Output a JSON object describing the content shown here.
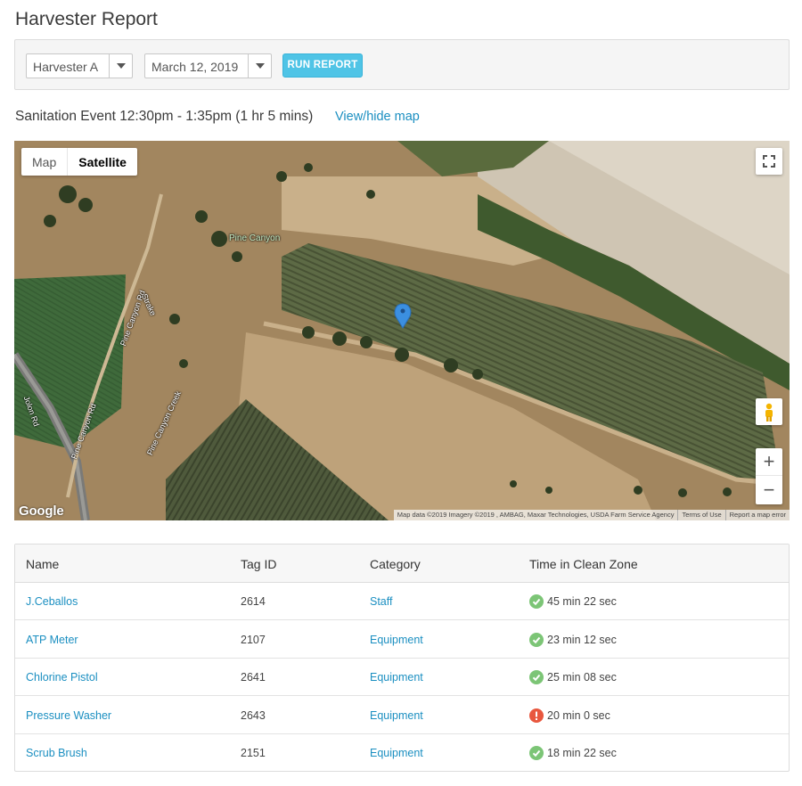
{
  "page": {
    "title": "Harvester Report"
  },
  "filters": {
    "harvester": "Harvester A",
    "date": "March 12, 2019",
    "run_label": "RUN REPORT"
  },
  "event": {
    "title": "Sanitation Event 12:30pm - 1:35pm (1 hr 5 mins)",
    "toggle_label": "View/hide map"
  },
  "map": {
    "type_map": "Map",
    "type_satellite": "Satellite",
    "google": "Google",
    "labels": {
      "pine_canyon": "Pine Canyon",
      "pine_canyon_rd": "Pine Canyon Rd",
      "strake": "Strake",
      "jolon_rd": "Jolon Rd",
      "pine_canyon_rd2": "Pine Canyon Rd",
      "pine_canyon_creek": "Pine Canyon Creek"
    },
    "attribution": {
      "data": "Map data ©2019 Imagery ©2019 , AMBAG, Maxar Technologies, USDA Farm Service Agency",
      "terms": "Terms of Use",
      "report": "Report a map error"
    },
    "zoom_in": "+",
    "zoom_out": "−",
    "colors": {
      "pin": "#3b8fe0"
    }
  },
  "table": {
    "headers": [
      "Name",
      "Tag ID",
      "Category",
      "Time in Clean Zone"
    ],
    "rows": [
      {
        "name": "J.Ceballos",
        "tag": "2614",
        "category": "Staff",
        "time": "45 min 22 sec",
        "status": "ok"
      },
      {
        "name": "ATP Meter",
        "tag": "2107",
        "category": "Equipment",
        "time": "23 min 12 sec",
        "status": "ok"
      },
      {
        "name": "Chlorine Pistol",
        "tag": "2641",
        "category": "Equipment",
        "time": "25 min 08 sec",
        "status": "ok"
      },
      {
        "name": "Pressure Washer",
        "tag": "2643",
        "category": "Equipment",
        "time": "20 min 0 sec",
        "status": "alert"
      },
      {
        "name": "Scrub Brush",
        "tag": "2151",
        "category": "Equipment",
        "time": "18 min 22 sec",
        "status": "ok"
      }
    ],
    "status_colors": {
      "ok": "#7cc576",
      "alert": "#e8573e"
    }
  }
}
